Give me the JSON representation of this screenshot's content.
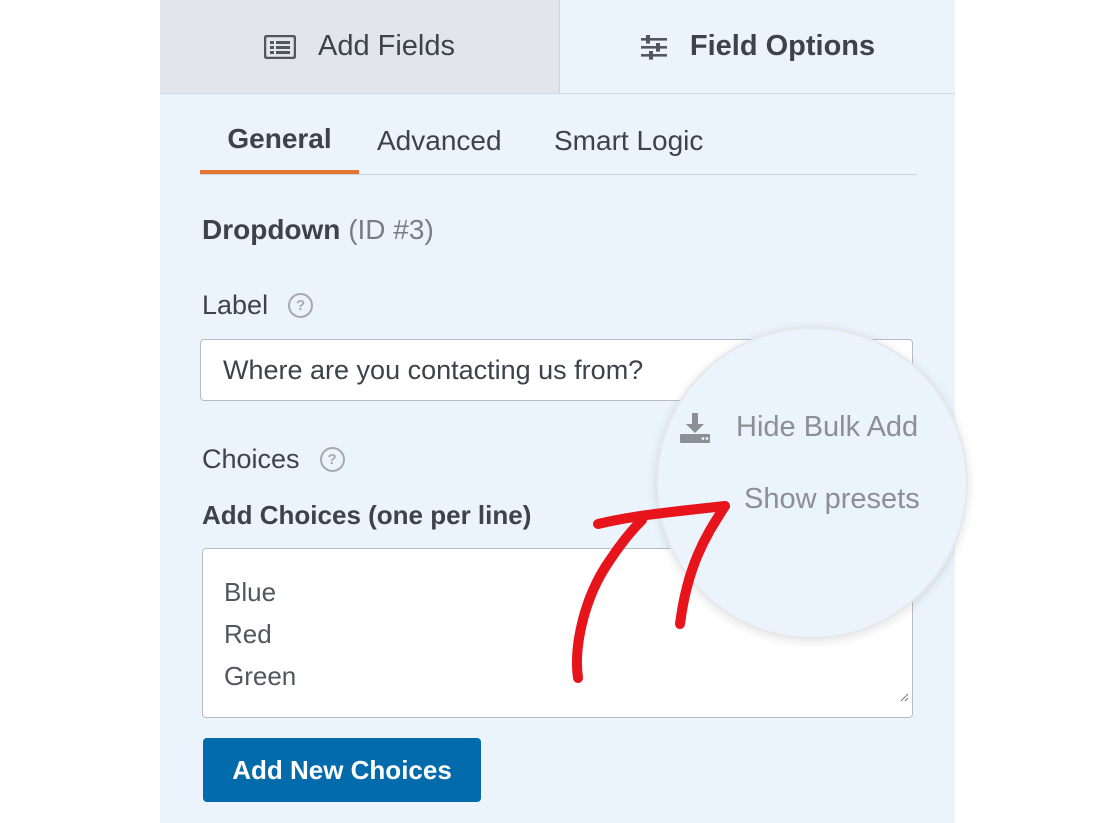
{
  "top_tabs": {
    "add_fields": "Add Fields",
    "field_options": "Field Options"
  },
  "sub_tabs": {
    "general": "General",
    "advanced": "Advanced",
    "smart_logic": "Smart Logic"
  },
  "field": {
    "type": "Dropdown",
    "id_text": "(ID #3)"
  },
  "label": {
    "title": "Label",
    "help": "?",
    "value": "Where are you contacting us from?"
  },
  "choices": {
    "title": "Choices",
    "help": "?",
    "bulk_heading": "Add Choices (one per line)",
    "items": [
      "Blue",
      "Red",
      "Green"
    ],
    "add_button": "Add New Choices"
  },
  "magnifier": {
    "hide_bulk_add": "Hide Bulk Add",
    "show_presets": "Show presets"
  },
  "colors": {
    "accent_tab": "#e27730",
    "button": "#036aab",
    "annotation_arrow": "#e8141b",
    "panel_bg": "#ebf3fc"
  }
}
